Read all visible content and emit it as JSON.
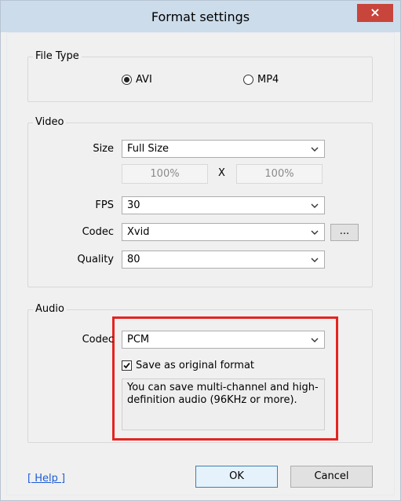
{
  "window": {
    "title": "Format settings",
    "close_glyph": "×"
  },
  "file_type": {
    "legend": "File Type",
    "options": [
      {
        "label": "AVI",
        "selected": true
      },
      {
        "label": "MP4",
        "selected": false
      }
    ]
  },
  "video": {
    "legend": "Video",
    "size_label": "Size",
    "size_value": "Full Size",
    "width_pct": "100%",
    "x_label": "X",
    "height_pct": "100%",
    "fps_label": "FPS",
    "fps_value": "30",
    "codec_label": "Codec",
    "codec_value": "Xvid",
    "codec_more": "...",
    "quality_label": "Quality",
    "quality_value": "80"
  },
  "audio": {
    "legend": "Audio",
    "codec_label": "Codec",
    "codec_value": "PCM",
    "save_original_label": "Save as original format",
    "save_original_checked": true,
    "info_text": "You can save multi-channel and high-definition audio (96KHz or more).",
    "highlight_color": "#e32421"
  },
  "footer": {
    "help_label": "[ Help ]",
    "ok_label": "OK",
    "cancel_label": "Cancel"
  }
}
